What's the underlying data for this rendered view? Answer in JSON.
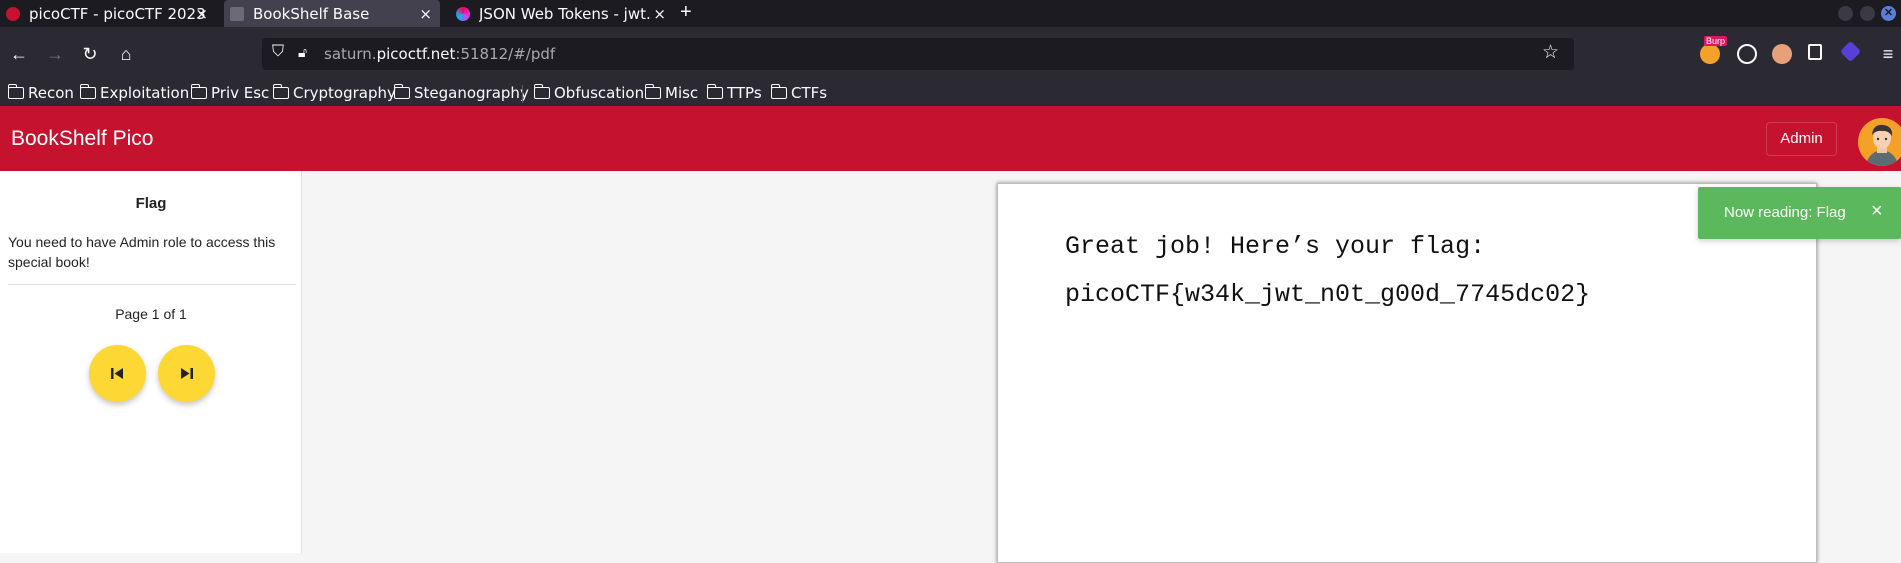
{
  "browser": {
    "tabs": [
      {
        "title": "picoCTF - picoCTF 2023",
        "active": false
      },
      {
        "title": "BookShelf Base",
        "active": true
      },
      {
        "title": "JSON Web Tokens - jwt.io",
        "active": false
      }
    ],
    "close_glyph": "×",
    "url": {
      "prefix": "saturn.",
      "host": "picoctf.net",
      "suffix": ":51812/#/pdf"
    },
    "bookmarks": [
      "Recon",
      "Exploitation",
      "Priv Esc",
      "Cryptography",
      "Steganography",
      "Obfuscation",
      "Misc",
      "TTPs",
      "CTFs"
    ],
    "extension_badge": "Burp"
  },
  "app": {
    "title": "BookShelf Pico",
    "admin_label": "Admin",
    "accent_color": "#c4122f"
  },
  "sidebar": {
    "book_title": "Flag",
    "description": "You need to have Admin role to access this special book!",
    "page_info": "Page 1 of 1"
  },
  "pdf": {
    "lines": [
      "Great job! Here’s your flag:",
      "picoCTF{w34k_jwt_n0t_g00d_7745dc02}"
    ]
  },
  "toast": {
    "text": "Now reading: Flag",
    "close_glyph": "×",
    "color": "#5cb85c"
  }
}
